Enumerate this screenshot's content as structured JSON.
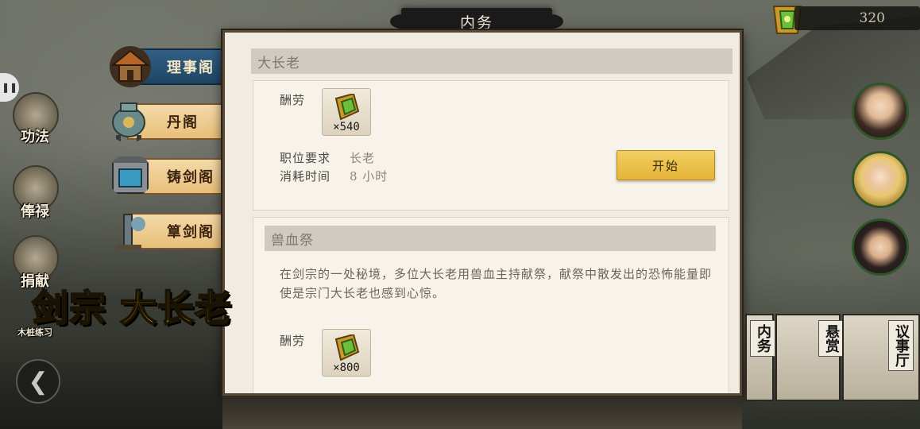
{
  "header": {
    "title": "内务"
  },
  "currency": {
    "amount": "320",
    "icon": "jade-token-icon"
  },
  "tabs": [
    {
      "label": "理事阁",
      "icon": "pavilion-icon",
      "active": true
    },
    {
      "label": "丹阁",
      "icon": "cauldron-icon",
      "active": false
    },
    {
      "label": "铸剑阁",
      "icon": "forge-icon",
      "active": false
    },
    {
      "label": "筸剑阁",
      "icon": "sword-tree-icon",
      "active": false
    }
  ],
  "side_nav": [
    {
      "label": "功法",
      "icon": "scroll-icon"
    },
    {
      "label": "俸禄",
      "icon": "hands-icon"
    },
    {
      "label": "捐献",
      "icon": "pouch-icon"
    },
    {
      "label": "木桩练习",
      "icon": "dummy-icon"
    }
  ],
  "caption": "剑宗 大长老",
  "task1": {
    "section_title": "大长老",
    "reward_label": "酬劳",
    "reward_qty": "×540",
    "req_label": "职位要求",
    "req_value": "长老",
    "time_label": "消耗时间",
    "time_value": "8 小时",
    "start_label": "开始"
  },
  "task2": {
    "section_title": "兽血祭",
    "description": "在剑宗的一处秘境，多位大长老用兽血主持献祭，献祭中散发出的恐怖能量即使是宗门大长老也感到心惊。",
    "reward_label": "酬劳",
    "reward_qty": "×800"
  },
  "right_cards": [
    {
      "label": "内务"
    },
    {
      "label": "悬赏"
    },
    {
      "label": "议事厅"
    }
  ],
  "colors": {
    "accent": "#e5b338",
    "active_tab": "#1f4564",
    "tab": "#e8bf7a",
    "caption": "#f5c21a"
  }
}
